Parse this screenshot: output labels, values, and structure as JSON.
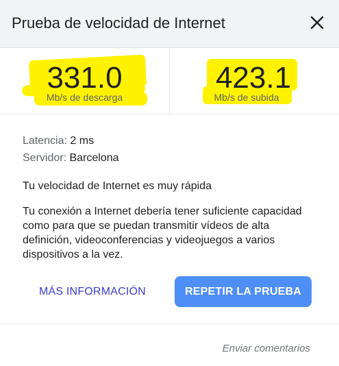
{
  "header": {
    "title": "Prueba de velocidad de Internet",
    "close_icon": "close-icon"
  },
  "download": {
    "value": "331.0",
    "unit": "Mb/s de descarga"
  },
  "upload": {
    "value": "423.1",
    "unit": "Mb/s de subida"
  },
  "details": {
    "latency_label": "Latencia:",
    "latency_value": "2 ms",
    "server_label": "Servidor:",
    "server_value": "Barcelona"
  },
  "summary": "Tu velocidad de Internet es muy rápida",
  "description": "Tu conexión a Internet debería tener suficiente capacidad como para que se puedan transmitir vídeos de alta definición, videoconferencias y videojuegos a varios dispositivos a la vez.",
  "actions": {
    "more_info_label": "MÁS INFORMACIÓN",
    "retry_label": "REPETIR LA PRUEBA"
  },
  "footer": {
    "feedback_label": "Enviar comentarios"
  },
  "colors": {
    "highlight": "#fff200",
    "primary_button": "#4e8ef7",
    "link": "#3c3ccc",
    "header_bg": "#f1f3f4"
  }
}
